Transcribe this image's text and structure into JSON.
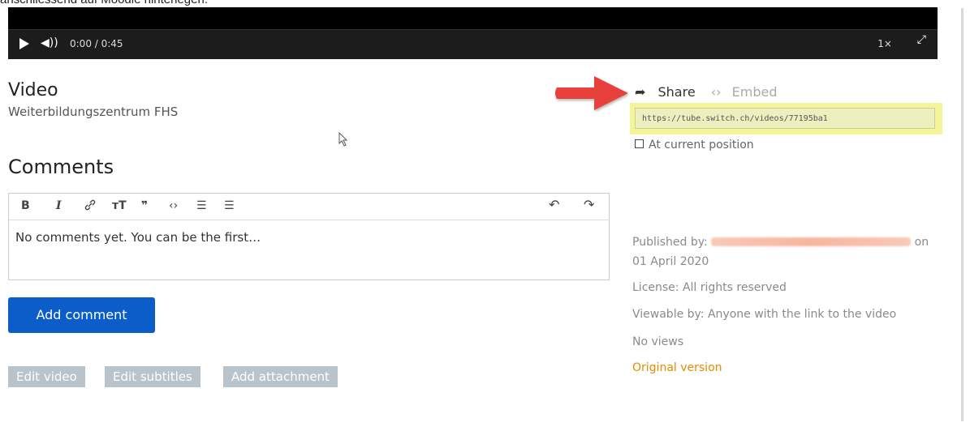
{
  "caption": "anschliessend auf Moodle hinterlegen.",
  "player": {
    "play_icon": "play-icon",
    "volume_icon": "volume-icon",
    "volume_glyph": "◀))",
    "time": "0:00 / 0:45",
    "speed": "1×",
    "fullscreen_glyph": "⤢"
  },
  "video": {
    "title": "Video",
    "owner": "Weiterbildungszentrum FHS"
  },
  "comments": {
    "heading": "Comments",
    "toolbar": {
      "bold": "B",
      "italic": "I",
      "link": "🔗",
      "heading": "ᴛT",
      "quote": "❞",
      "code": "‹›",
      "bullets": "☰",
      "numbers": "☰",
      "undo": "↶",
      "redo": "↷"
    },
    "placeholder": "No comments yet. You can be the first…",
    "add_button": "Add comment"
  },
  "actions": {
    "edit_video": "Edit video",
    "edit_subtitles": "Edit subtitles",
    "add_attachment": "Add attachment"
  },
  "share": {
    "share_label": "Share",
    "embed_label": "Embed",
    "share_glyph": "➦",
    "embed_glyph": "‹›",
    "url": "https://tube.switch.ch/videos/77195ba1",
    "position_label": "At current position"
  },
  "details": {
    "published_prefix": "Published by:",
    "published_suffix": "on",
    "published_date": "01 April 2020",
    "license": "License: All rights reserved",
    "viewable": "Viewable by: Anyone with the link to the video",
    "views": "No views",
    "original": "Original version"
  },
  "colors": {
    "annotation_arrow": "#e8413a",
    "highlight": "#f2f59a",
    "primary_button": "#0b5dc9",
    "link_orange": "#e68a00"
  }
}
